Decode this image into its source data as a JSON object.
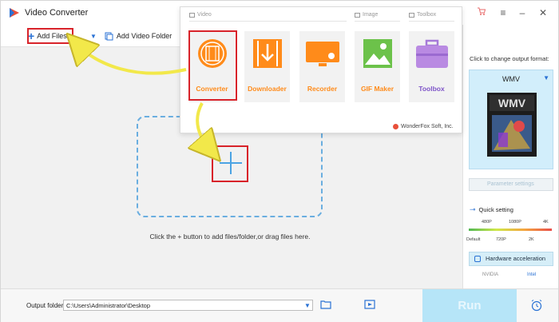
{
  "window": {
    "title": "Video Converter"
  },
  "toolbar": {
    "add_files_label": "Add Files",
    "add_folder_label": "Add Video Folder"
  },
  "popup": {
    "categories": {
      "video": "Video",
      "image": "Image",
      "toolbox": "Toolbox"
    },
    "tiles": [
      {
        "label": "Converter",
        "icon": "film-icon"
      },
      {
        "label": "Downloader",
        "icon": "download-icon"
      },
      {
        "label": "Recorder",
        "icon": "screen-record-icon"
      },
      {
        "label": "GIF Maker",
        "icon": "image-landscape-icon"
      },
      {
        "label": "Toolbox",
        "icon": "toolbox-icon"
      }
    ],
    "brand": "WonderFox Soft, Inc."
  },
  "main": {
    "drop_hint": "Click the + button to add files/folder,or drag files here."
  },
  "right_panel": {
    "caption": "Click to change output format:",
    "format": {
      "name": "WMV",
      "badge": "WMV"
    },
    "parameter_settings": "Parameter settings",
    "quick_setting": "Quick setting",
    "quality_top": [
      "480P",
      "1080P",
      "4K"
    ],
    "quality_bottom": [
      "Default",
      "720P",
      "2K"
    ],
    "hardware_acceleration": "Hardware acceleration",
    "gpu_nvidia": "NVIDIA",
    "gpu_intel": "Intel"
  },
  "bottom": {
    "output_label": "Output folder:",
    "output_path": "C:\\Users\\Administrator\\Desktop",
    "run_label": "Run"
  },
  "colors": {
    "accent_blue": "#2a72d4",
    "orange": "#ff8b1a",
    "highlight_red": "#d8232a",
    "run_bg": "#b6e5f8"
  }
}
